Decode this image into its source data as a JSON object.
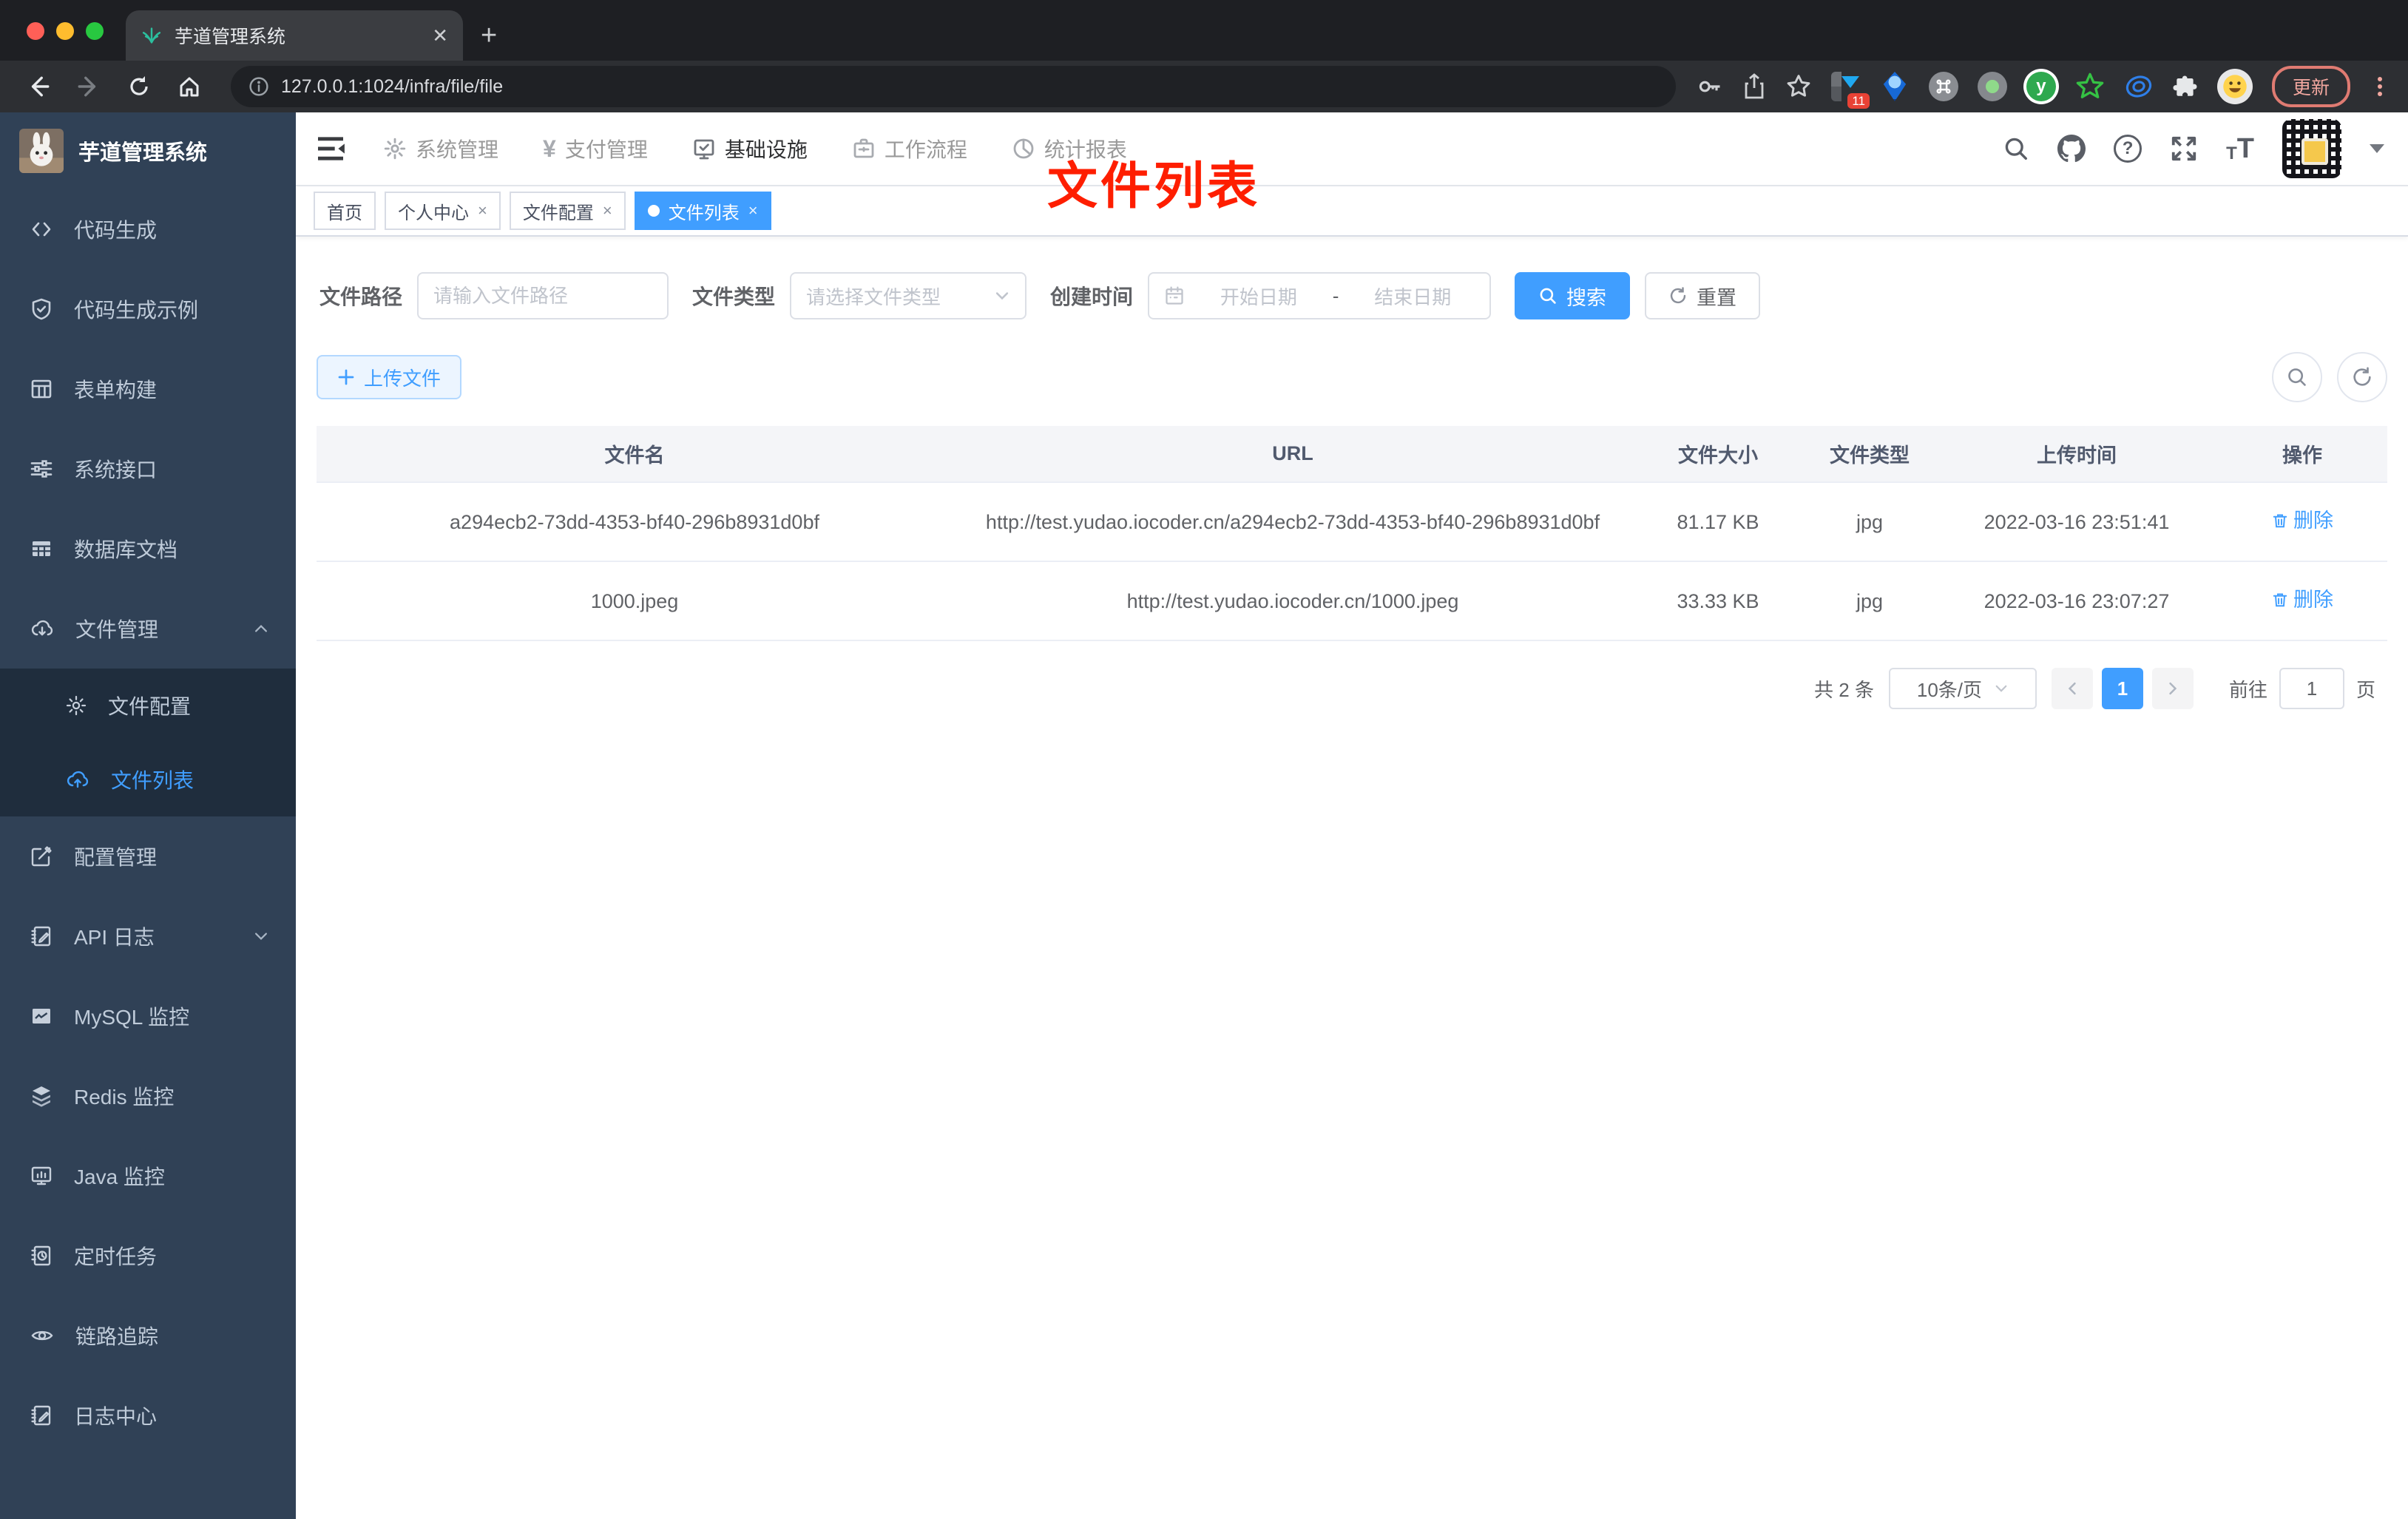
{
  "browser": {
    "tab_title": "芋道管理系统",
    "close_glyph": "✕",
    "new_tab_glyph": "+",
    "url": "127.0.0.1:1024/infra/file/file",
    "ext_badge": "11",
    "update_label": "更新"
  },
  "app_header": {
    "nav": [
      {
        "label": "系统管理"
      },
      {
        "label": "支付管理",
        "icon_glyph": "¥"
      },
      {
        "label": "基础设施"
      },
      {
        "label": "工作流程"
      },
      {
        "label": "统计报表"
      }
    ],
    "help_glyph": "?",
    "text_size_small": "T",
    "text_size_large": "T"
  },
  "sidebar": {
    "title": "芋道管理系统",
    "items": [
      {
        "label": "代码生成"
      },
      {
        "label": "代码生成示例"
      },
      {
        "label": "表单构建"
      },
      {
        "label": "系统接口"
      },
      {
        "label": "数据库文档"
      },
      {
        "label": "文件管理"
      },
      {
        "label": "文件配置"
      },
      {
        "label": "文件列表"
      },
      {
        "label": "配置管理"
      },
      {
        "label": "API 日志"
      },
      {
        "label": "MySQL 监控"
      },
      {
        "label": "Redis 监控"
      },
      {
        "label": "Java 监控"
      },
      {
        "label": "定时任务"
      },
      {
        "label": "链路追踪"
      },
      {
        "label": "日志中心"
      }
    ]
  },
  "tags": {
    "close_glyph": "×",
    "items": [
      {
        "label": "首页"
      },
      {
        "label": "个人中心"
      },
      {
        "label": "文件配置"
      },
      {
        "label": "文件列表"
      }
    ]
  },
  "annotation": {
    "text": "文件列表",
    "color": "#fe1e00"
  },
  "filter": {
    "path_label": "文件路径",
    "path_placeholder": "请输入文件路径",
    "type_label": "文件类型",
    "type_placeholder": "请选择文件类型",
    "date_label": "创建时间",
    "date_start_placeholder": "开始日期",
    "date_separator": "-",
    "date_end_placeholder": "结束日期",
    "search_label": "搜索",
    "reset_label": "重置"
  },
  "toolbar": {
    "upload_label": "上传文件"
  },
  "table": {
    "headers": [
      "文件名",
      "URL",
      "文件大小",
      "文件类型",
      "上传时间",
      "操作"
    ],
    "rows": [
      {
        "name": "a294ecb2-73dd-4353-bf40-296b8931d0bf",
        "url": "http://test.yudao.iocoder.cn/a294ecb2-73dd-4353-bf40-296b8931d0bf",
        "size": "81.17 KB",
        "type": "jpg",
        "time": "2022-03-16 23:51:41",
        "action": "删除"
      },
      {
        "name": "1000.jpeg",
        "url": "http://test.yudao.iocoder.cn/1000.jpeg",
        "size": "33.33 KB",
        "type": "jpg",
        "time": "2022-03-16 23:07:27",
        "action": "删除"
      }
    ]
  },
  "pagination": {
    "total": "共 2 条",
    "page_size": "10条/页",
    "page": "1",
    "goto_label": "前往",
    "goto_value": "1",
    "unit_label": "页"
  },
  "colors": {
    "accent": "#409EFF",
    "sidebar_bg": "#304156",
    "submenu_bg": "#1f2d3d",
    "annotation_red": "#fe1e00"
  }
}
